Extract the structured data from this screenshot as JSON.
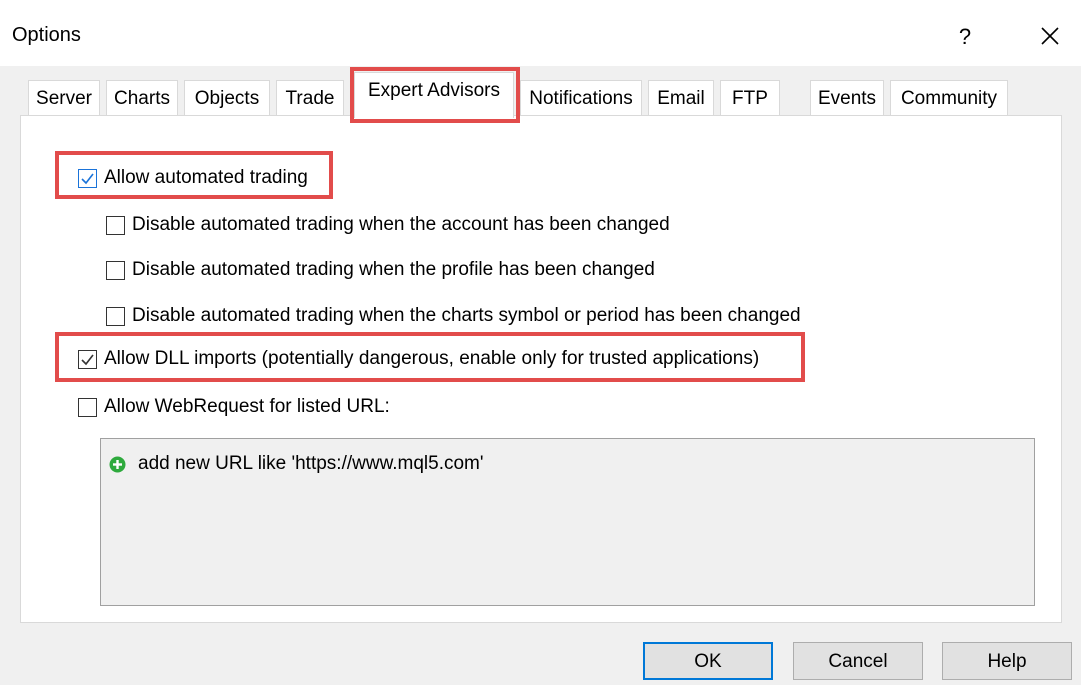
{
  "window": {
    "title": "Options",
    "help_label": "?"
  },
  "tabs": [
    {
      "label": "Server"
    },
    {
      "label": "Charts"
    },
    {
      "label": "Objects"
    },
    {
      "label": "Trade"
    },
    {
      "label": "Expert Advisors",
      "active": true
    },
    {
      "label": "Notifications"
    },
    {
      "label": "Email"
    },
    {
      "label": "FTP"
    },
    {
      "label": "Events"
    },
    {
      "label": "Community"
    }
  ],
  "options": {
    "allow_automated": {
      "label": "Allow automated trading",
      "checked": true
    },
    "disable_account": {
      "label": "Disable automated trading when the account has been changed",
      "checked": false
    },
    "disable_profile": {
      "label": "Disable automated trading when the profile has been changed",
      "checked": false
    },
    "disable_symbol": {
      "label": "Disable automated trading when the charts symbol or period has been changed",
      "checked": false
    },
    "allow_dll": {
      "label": "Allow DLL imports (potentially dangerous, enable only for trusted applications)",
      "checked": true
    },
    "allow_webrequest": {
      "label": "Allow WebRequest for listed URL:",
      "checked": false
    }
  },
  "url_list": {
    "add_label": "add new URL like 'https://www.mql5.com'"
  },
  "buttons": {
    "ok": "OK",
    "cancel": "Cancel",
    "help": "Help"
  },
  "colors": {
    "highlight": "#e24c4b",
    "check_blue": "#1a73d9",
    "add_icon_green": "#2eaa3d"
  }
}
